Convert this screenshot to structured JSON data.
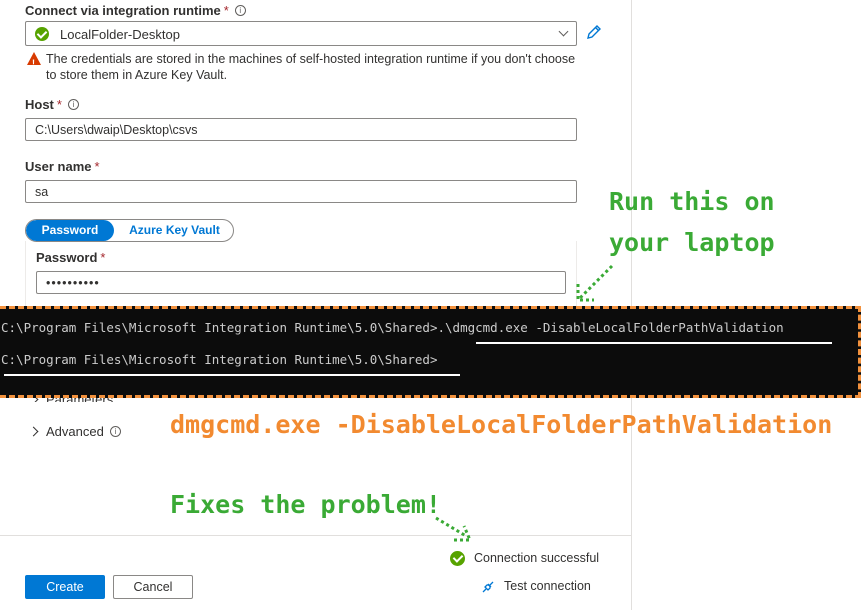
{
  "form": {
    "runtime": {
      "label": "Connect via integration runtime",
      "required": "*",
      "value": "LocalFolder-Desktop",
      "warning": "The credentials are stored in the machines of self-hosted integration runtime if you don't choose to store them in Azure Key Vault."
    },
    "host": {
      "label": "Host",
      "required": "*",
      "value": "C:\\Users\\dwaip\\Desktop\\csvs"
    },
    "username": {
      "label": "User name",
      "required": "*",
      "value": "sa"
    },
    "auth_toggle": {
      "password_label": "Password",
      "keyvault_label": "Azure Key Vault"
    },
    "password": {
      "label": "Password",
      "required": "*",
      "value": "••••••••••"
    },
    "sections": {
      "parameters": "Parameters",
      "advanced": "Advanced"
    },
    "status": {
      "text": "Connection successful"
    },
    "test_connection": "Test connection",
    "buttons": {
      "create": "Create",
      "cancel": "Cancel"
    }
  },
  "terminal": {
    "line1": "C:\\Program Files\\Microsoft Integration Runtime\\5.0\\Shared>.\\dmgcmd.exe -DisableLocalFolderPathValidation",
    "line2": "C:\\Program Files\\Microsoft Integration Runtime\\5.0\\Shared>"
  },
  "annotations": {
    "run_line1": "Run this on",
    "run_line2": "your laptop",
    "command": "dmgcmd.exe -DisableLocalFolderPathValidation",
    "fixes": "Fixes the problem!"
  },
  "colors": {
    "accent": "#0078d4",
    "success": "#57a300",
    "warning": "#d83b01",
    "annotation_green": "#3aaa35",
    "annotation_orange": "#f28a30"
  }
}
